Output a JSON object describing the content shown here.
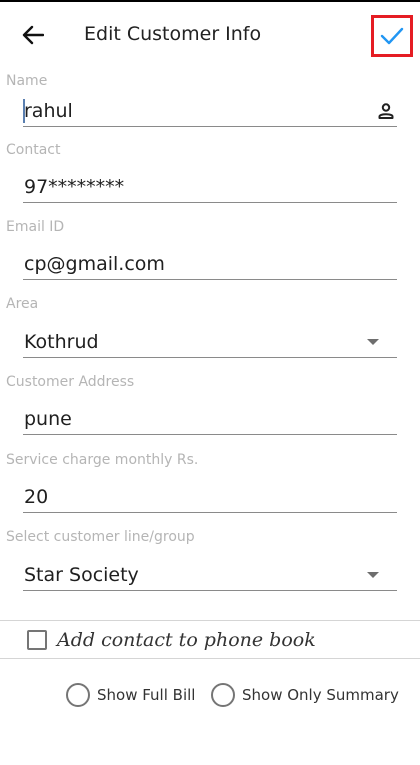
{
  "header": {
    "title": "Edit Customer Info",
    "back_icon": "arrow-left-icon",
    "save_icon": "check-icon",
    "save_highlight_color": "#e51c23",
    "check_color": "#2196f3"
  },
  "fields": {
    "name": {
      "label": "Name",
      "value": "rahul",
      "icon": "person-icon"
    },
    "contact": {
      "label": "Contact",
      "value": "97********"
    },
    "email": {
      "label": "Email ID",
      "value": "cp@gmail.com"
    },
    "area": {
      "label": "Area",
      "value": "Kothrud",
      "icon": "dropdown-arrow-icon"
    },
    "address": {
      "label": "Customer Address",
      "value": "pune"
    },
    "service_charge": {
      "label": "Service charge monthly Rs.",
      "value": "20"
    },
    "customer_group": {
      "label": "Select customer line/group",
      "value": "Star Society",
      "icon": "dropdown-arrow-icon"
    }
  },
  "checkbox": {
    "label": "Add contact to phone book",
    "checked": false
  },
  "bill_options": [
    {
      "label": "Show Full Bill",
      "selected": false
    },
    {
      "label": "Show Only Summary",
      "selected": false
    }
  ]
}
